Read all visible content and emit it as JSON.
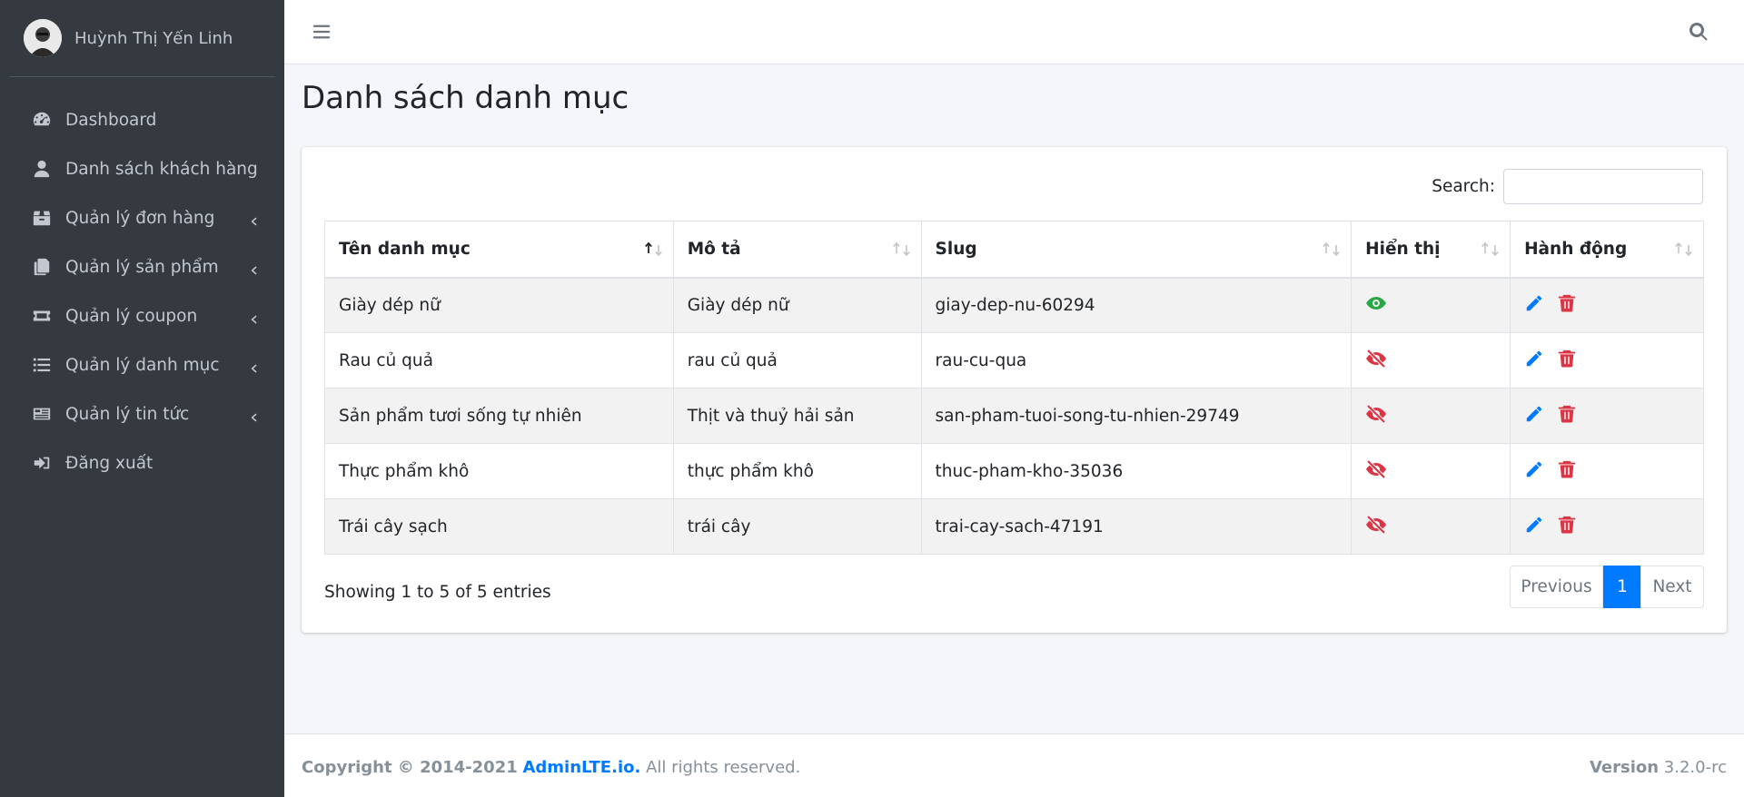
{
  "sidebar": {
    "user_name": "Huỳnh Thị Yến Linh",
    "items": [
      {
        "label": "Dashboard",
        "icon": "dashboard-icon",
        "has_children": false
      },
      {
        "label": "Danh sách khách hàng",
        "icon": "user-icon",
        "has_children": false
      },
      {
        "label": "Quản lý đơn hàng",
        "icon": "box-icon",
        "has_children": true
      },
      {
        "label": "Quản lý sản phẩm",
        "icon": "copy-icon",
        "has_children": true
      },
      {
        "label": "Quản lý coupon",
        "icon": "ticket-icon",
        "has_children": true
      },
      {
        "label": "Quản lý danh mục",
        "icon": "list-icon",
        "has_children": true
      },
      {
        "label": "Quản lý tin tức",
        "icon": "news-icon",
        "has_children": true
      },
      {
        "label": "Đăng xuất",
        "icon": "sign-out-icon",
        "has_children": false
      }
    ]
  },
  "header": {
    "menu_icon": "bars-icon",
    "search_icon": "search-icon"
  },
  "main": {
    "title": "Danh sách danh mục",
    "search_label": "Search:",
    "search_value": "",
    "columns": [
      "Tên danh mục",
      "Mô tả",
      "Slug",
      "Hiển thị",
      "Hành động"
    ],
    "rows": [
      {
        "name": "Giày dép nữ",
        "description": "Giày dép nữ",
        "slug": "giay-dep-nu-60294",
        "visible": true
      },
      {
        "name": "Rau củ quả",
        "description": "rau củ quả",
        "slug": "rau-cu-qua",
        "visible": false
      },
      {
        "name": "Sản phẩm tươi sống tự nhiên",
        "description": "Thịt và thuỷ hải sản",
        "slug": "san-pham-tuoi-song-tu-nhien-29749",
        "visible": false
      },
      {
        "name": "Thực phẩm khô",
        "description": "thực phẩm khô",
        "slug": "thuc-pham-kho-35036",
        "visible": false
      },
      {
        "name": "Trái cây sạch",
        "description": "trái cây",
        "slug": "trai-cay-sach-47191",
        "visible": false
      }
    ],
    "info": "Showing 1 to 5 of 5 entries",
    "pagination": {
      "previous": "Previous",
      "current": "1",
      "next": "Next"
    }
  },
  "footer": {
    "copyright_prefix": "Copyright © 2014-2021",
    "brand": "AdminLTE.io.",
    "rights": "All rights reserved.",
    "version_label": "Version",
    "version_value": "3.2.0-rc"
  },
  "colors": {
    "sidebar_bg": "#343a40",
    "primary": "#007bff",
    "visible_eye": "#28a745",
    "hidden_eye": "#dc3545",
    "edit": "#007bff",
    "delete": "#dc3545"
  }
}
